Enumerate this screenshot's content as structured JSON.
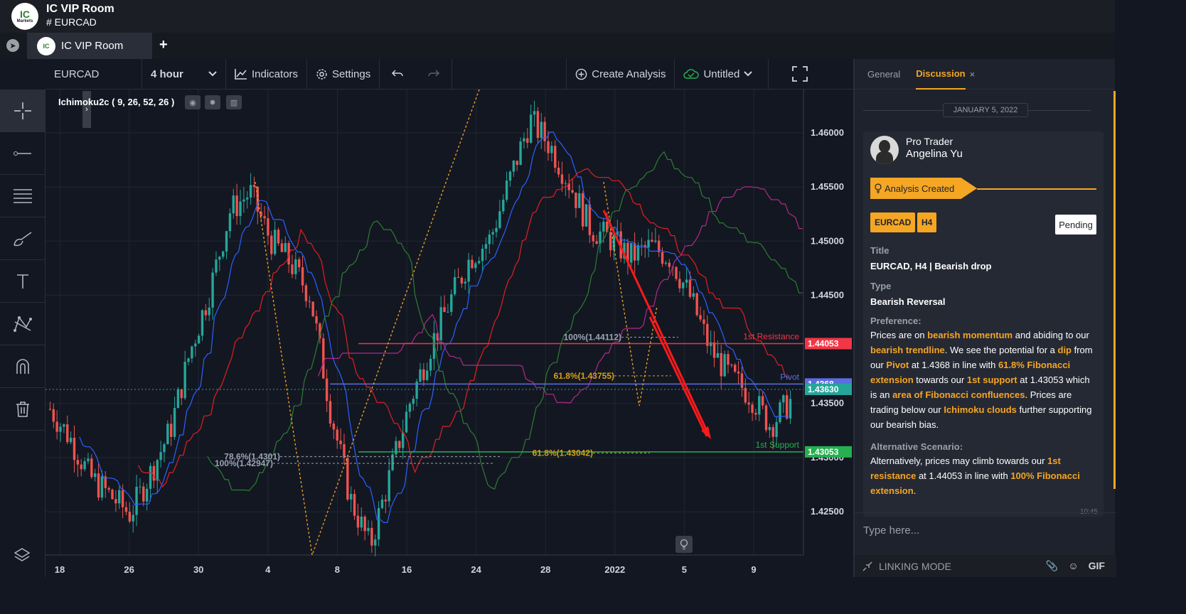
{
  "app": {
    "logo_top": "IC",
    "logo_bottom": "Markets",
    "room_title": "IC VIP Room",
    "room_channel": "# EURCAD"
  },
  "tabs": [
    {
      "label": "IC VIP Room",
      "active": true
    }
  ],
  "tab_add": "+",
  "toolbar": {
    "symbol": "EURCAD",
    "interval": "4 hour",
    "indicators": "Indicators",
    "settings": "Settings",
    "create_analysis": "Create Analysis",
    "layout_name": "Untitled"
  },
  "indicator": {
    "label": "Ichimoku2c ( 9, 26, 52, 26 )"
  },
  "left_tools": [
    "crosshair-icon",
    "trend-line-icon",
    "fib-lines-icon",
    "brush-icon",
    "text-icon",
    "pattern-icon",
    "magnet-icon",
    "trash-icon"
  ],
  "chart_data": {
    "type": "candlestick",
    "symbol": "EURCAD",
    "interval": "4 hour",
    "x_ticks": [
      "18",
      "26",
      "30",
      "4",
      "8",
      "16",
      "24",
      "28",
      "2022",
      "5",
      "9"
    ],
    "y_ticks": [
      "1.46000",
      "1.45500",
      "1.45000",
      "1.44500",
      "1.43500",
      "1.43000",
      "1.42500"
    ],
    "ylim": [
      1.421,
      1.464
    ],
    "levels": [
      {
        "name": "1st Resistance",
        "value": 1.44053,
        "label": "1.44053",
        "color": "#f23645"
      },
      {
        "name": "Pivot",
        "value": 1.4368,
        "label": "1.4368",
        "color": "#5b6ee1"
      },
      {
        "name": "1st Support",
        "value": 1.43053,
        "label": "1.43053",
        "color": "#26b04f"
      }
    ],
    "last_price": {
      "value": 1.4363,
      "label": "1.43630",
      "color": "#26a69a"
    },
    "fib_labels": [
      {
        "text": "100%(1.44112)",
        "value": 1.44112
      },
      {
        "text": "61.8%(1.43755)",
        "value": 1.43755
      },
      {
        "text": "61.8%(1.43042)",
        "value": 1.43042
      },
      {
        "text": "78.6%(1.4301)",
        "value": 1.4301
      },
      {
        "text": "100%(1.42947)",
        "value": 1.42947
      }
    ],
    "price_path": [
      1.4345,
      1.4318,
      1.4282,
      1.4265,
      1.4248,
      1.4285,
      1.4325,
      1.4398,
      1.4455,
      1.4528,
      1.4545,
      1.4502,
      1.448,
      1.445,
      1.4345,
      1.4262,
      1.4218,
      1.4285,
      1.4352,
      1.4402,
      1.4445,
      1.4485,
      1.4502,
      1.4558,
      1.4612,
      1.4588,
      1.4552,
      1.4512,
      1.4502,
      1.4485,
      1.4495,
      1.4485,
      1.4448,
      1.44,
      1.4375,
      1.4358,
      1.433,
      1.4352
    ]
  },
  "panel": {
    "tab_general": "General",
    "tab_discussion": "Discussion",
    "close": "×",
    "date": "JANUARY 5, 2022",
    "author_role": "Pro Trader",
    "author_name": "Angelina Yu",
    "analysis_created": "Analysis Created",
    "badge_symbol": "EURCAD",
    "badge_tf": "H4",
    "status": "Pending",
    "title_label": "Title",
    "title_value": "EURCAD, H4 | Bearish drop",
    "type_label": "Type",
    "type_value": "Bearish Reversal",
    "preference_label": "Preference:",
    "alt_label": "Alternative Scenario:",
    "timestamp": "10:45",
    "input_placeholder": "Type here...",
    "linking_mode": "LINKING MODE",
    "gif": "GIF",
    "accent": "#f5a623"
  },
  "preference_text": [
    {
      "t": "Prices are on ",
      "h": false
    },
    {
      "t": "bearish momentum",
      "h": true
    },
    {
      "t": " and abiding to our ",
      "h": false
    },
    {
      "t": "bearish trendline",
      "h": true
    },
    {
      "t": ". We see the potential for a ",
      "h": false
    },
    {
      "t": "dip",
      "h": true
    },
    {
      "t": " from our ",
      "h": false
    },
    {
      "t": "Pivot",
      "h": true
    },
    {
      "t": " at 1.4368 in line with ",
      "h": false
    },
    {
      "t": "61.8% Fibonacci extension",
      "h": true
    },
    {
      "t": " towards our ",
      "h": false
    },
    {
      "t": "1st support",
      "h": true
    },
    {
      "t": " at 1.43053 which is an ",
      "h": false
    },
    {
      "t": "area of Fibonacci confluences.",
      "h": true
    },
    {
      "t": " Prices are trading below our ",
      "h": false
    },
    {
      "t": "Ichimoku clouds",
      "h": true
    },
    {
      "t": " further supporting our bearish bias.",
      "h": false
    }
  ],
  "alt_text": [
    {
      "t": "Alternatively, prices may climb towards our ",
      "h": false
    },
    {
      "t": "1st resistance",
      "h": true
    },
    {
      "t": " at 1.44053 in line with ",
      "h": false
    },
    {
      "t": "100% Fibonacci extension",
      "h": true
    },
    {
      "t": ".",
      "h": false
    }
  ]
}
